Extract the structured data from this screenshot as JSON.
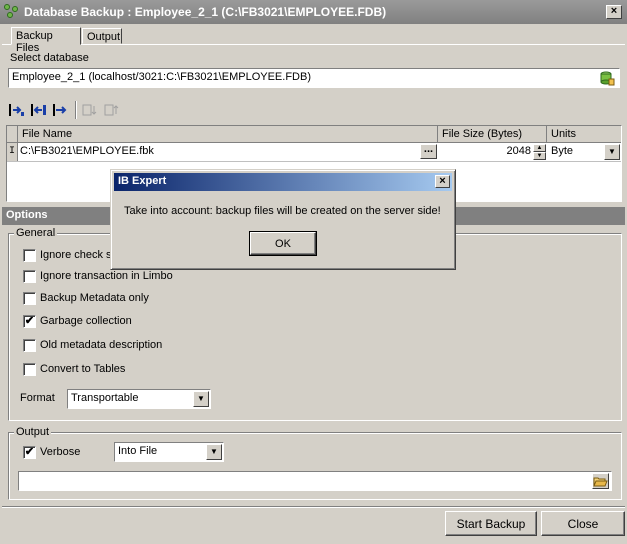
{
  "window": {
    "title": "Database Backup : Employee_2_1 (C:\\FB3021\\EMPLOYEE.FDB)",
    "close": "×"
  },
  "tabs": [
    {
      "label": "Backup Files"
    },
    {
      "label": "Output"
    }
  ],
  "select_db": {
    "label": "Select database",
    "value": "Employee_2_1 (localhost/3021:C:\\FB3021\\EMPLOYEE.FDB)"
  },
  "toolbar": {
    "icons": [
      "add-file-icon",
      "insert-file-icon",
      "delete-file-icon",
      "move-down-icon",
      "move-up-icon"
    ]
  },
  "grid": {
    "columns": [
      "File Name",
      "File Size (Bytes)",
      "Units"
    ],
    "rows": [
      {
        "indicator": "I",
        "file_name": "C:\\FB3021\\EMPLOYEE.fbk",
        "ellipsis": "...",
        "size": "2048",
        "units": "Byte"
      }
    ]
  },
  "options": {
    "header": "Options",
    "general_label": "General",
    "checkboxes": [
      {
        "label": "Ignore check s",
        "checked": false
      },
      {
        "label": "Ignore transaction in Limbo",
        "checked": false
      },
      {
        "label": "Backup Metadata only",
        "checked": false
      },
      {
        "label": "Garbage collection",
        "checked": true
      },
      {
        "label": "Old metadata description",
        "checked": false
      },
      {
        "label": "Convert to Tables",
        "checked": false
      }
    ],
    "format_label": "Format",
    "format_value": "Transportable"
  },
  "output": {
    "label": "Output",
    "verbose_label": "Verbose",
    "verbose_checked": true,
    "verbose_target": "Into File",
    "file_path": ""
  },
  "buttons": {
    "start": "Start Backup",
    "close": "Close"
  },
  "dialog": {
    "title": "IB Expert",
    "message": "Take into account: backup files will be created on the server side!",
    "ok": "OK",
    "close": "×"
  },
  "colors": {
    "title_gradient_start": "#0a246a",
    "title_gradient_end": "#a6caf0",
    "options_bar": "#808080"
  }
}
